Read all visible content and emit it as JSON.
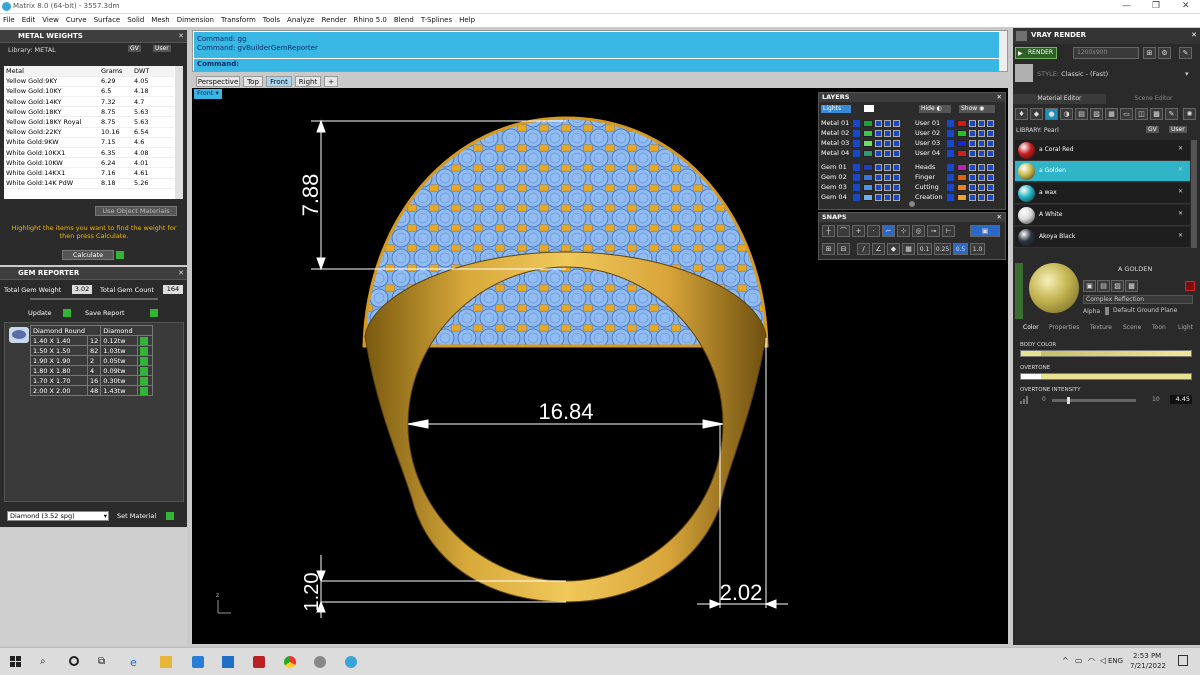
{
  "window": {
    "title": "Matrix 8.0 (64-bit) - 3557.3dm",
    "minimize": "—",
    "maximize": "❐",
    "close": "✕"
  },
  "menu": [
    "File",
    "Edit",
    "View",
    "Curve",
    "Surface",
    "Solid",
    "Mesh",
    "Dimension",
    "Transform",
    "Tools",
    "Analyze",
    "Render",
    "Rhino 5.0",
    "Blend",
    "T-Splines",
    "Help"
  ],
  "metal_weights": {
    "title": "METAL WEIGHTS",
    "library_label": "Library: METAL",
    "gv_btn": "GV",
    "user_btn": "User",
    "columns": [
      "Metal",
      "Grams",
      "DWT"
    ],
    "rows": [
      [
        "Yellow Gold:9KY",
        "6.29",
        "4.05"
      ],
      [
        "Yellow Gold:10KY",
        "6.5",
        "4.18"
      ],
      [
        "Yellow Gold:14KY",
        "7.32",
        "4.7"
      ],
      [
        "Yellow Gold:18KY",
        "8.75",
        "5.63"
      ],
      [
        "Yellow Gold:18KY Royal",
        "8.75",
        "5.63"
      ],
      [
        "Yellow Gold:22KY",
        "10.16",
        "6.54"
      ],
      [
        "White Gold:9KW",
        "7.15",
        "4.6"
      ],
      [
        "White Gold:10KX1",
        "6.35",
        "4.08"
      ],
      [
        "White Gold:10KW",
        "6.24",
        "4.01"
      ],
      [
        "White Gold:14KX1",
        "7.16",
        "4.61"
      ],
      [
        "White Gold:14K PdW",
        "8.18",
        "5.26"
      ]
    ],
    "use_object_materials": "Use Object Materials",
    "instructions": "Highlight the items you want to find the weight for then press Calculate.",
    "calculate": "Calculate"
  },
  "gem_reporter": {
    "title": "GEM REPORTER",
    "total_weight_label": "Total Gem Weight",
    "total_weight": "3.02",
    "total_count_label": "Total Gem Count",
    "total_count": "164",
    "update": "Update",
    "save_report": "Save Report",
    "col_shape": "Diamond Round",
    "col_type": "Diamond",
    "rows": [
      [
        "1.40 X 1.40",
        "12",
        "0.12tw"
      ],
      [
        "1.50 X 1.50",
        "82",
        "1.03tw"
      ],
      [
        "1.90 X 1.90",
        "2",
        "0.05tw"
      ],
      [
        "1.80 X 1.80",
        "4",
        "0.09tw"
      ],
      [
        "1.70 X 1.70",
        "16",
        "0.30tw"
      ],
      [
        "2.00 X 2.00",
        "48",
        "1.43tw"
      ]
    ],
    "material_select": "Diamond      (3.52 spg)",
    "set_material": "Set Material"
  },
  "command": {
    "line1": "Command: gg",
    "line2": "Command: gvBuilderGemReporter",
    "prompt": "Command:"
  },
  "viewport_tabs": [
    "Perspective",
    "Top",
    "Front",
    "Right",
    "+"
  ],
  "viewport_label": "Front",
  "dimensions": {
    "top": "7.88",
    "width": "16.84",
    "bottom": "1.20",
    "shank": "2.02"
  },
  "layers": {
    "title": "LAYERS",
    "lights": "Lights",
    "hide": "Hide",
    "show": "Show",
    "left": [
      {
        "name": "Metal 01",
        "color": "#1f9e3c"
      },
      {
        "name": "Metal 02",
        "color": "#36c84a"
      },
      {
        "name": "Metal 03",
        "color": "#69e35d"
      },
      {
        "name": "Metal 04",
        "color": "#2f9a70"
      },
      {
        "name": "Gem 01",
        "color": "#1d3fbf"
      },
      {
        "name": "Gem 02",
        "color": "#3b74dd"
      },
      {
        "name": "Gem 03",
        "color": "#4f94e8"
      },
      {
        "name": "Gem 04",
        "color": "#6fb1f0"
      }
    ],
    "right": [
      {
        "name": "User 01",
        "color": "#e01414"
      },
      {
        "name": "User 02",
        "color": "#21c321"
      },
      {
        "name": "User 03",
        "color": "#1827d8"
      },
      {
        "name": "User 04",
        "color": "#d02020"
      },
      {
        "name": "Heads",
        "color": "#b824b8"
      },
      {
        "name": "Finger",
        "color": "#e06010"
      },
      {
        "name": "Cutting",
        "color": "#f08020"
      },
      {
        "name": "Creation",
        "color": "#f0a030"
      }
    ]
  },
  "snaps": {
    "title": "SNAPS",
    "values": [
      "0.1",
      "0.25",
      "0.5",
      "1.0"
    ]
  },
  "vray": {
    "title": "VRAY RENDER",
    "render": "RENDER",
    "resolution": "1200x900",
    "style": "Classic - (Fast)",
    "tab_material": "Material Editor",
    "tab_scene": "Scene Editor",
    "library": "LIBRARY: Pearl",
    "gv": "GV",
    "user": "User",
    "materials": [
      {
        "name": "a Coral Red",
        "color": "#c41a1a"
      },
      {
        "name": "a Golden",
        "color": "#c9b648"
      },
      {
        "name": "a wax",
        "color": "#22b4c2"
      },
      {
        "name": "A White",
        "color": "#d8d8d8"
      },
      {
        "name": "Akoya Black",
        "color": "#2b3442"
      }
    ],
    "selected": "A GOLDEN",
    "reflection": "Complex Reflection",
    "alpha": "Alpha",
    "ground": "Default Ground Plane",
    "prop_tabs": [
      "Color",
      "Properties",
      "Texture",
      "Scene",
      "Toon",
      "Light"
    ],
    "body_color": "BODY COLOR",
    "overtone": "OVERTONE",
    "overtone_intensity": "OVERTONE INTENSITY",
    "intensity_min": "0",
    "intensity_max": "10",
    "intensity_value": "4.45"
  },
  "taskbar": {
    "lang": "ENG",
    "time": "2:53 PM",
    "date": "7/21/2022"
  }
}
